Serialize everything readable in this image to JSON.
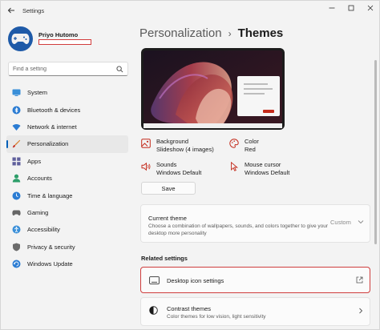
{
  "window": {
    "title": "Settings",
    "back_icon": "arrow-left-icon",
    "controls": [
      "minimize",
      "maximize",
      "close"
    ]
  },
  "user": {
    "name": "Priyo Hutomo",
    "email": ""
  },
  "search": {
    "placeholder": "Find a setting",
    "value": ""
  },
  "sidebar": {
    "items": [
      {
        "label": "System",
        "icon": "monitor-icon",
        "active": false
      },
      {
        "label": "Bluetooth & devices",
        "icon": "bluetooth-icon",
        "active": false
      },
      {
        "label": "Network & internet",
        "icon": "wifi-icon",
        "active": false
      },
      {
        "label": "Personalization",
        "icon": "brush-icon",
        "active": true
      },
      {
        "label": "Apps",
        "icon": "apps-icon",
        "active": false
      },
      {
        "label": "Accounts",
        "icon": "person-icon",
        "active": false
      },
      {
        "label": "Time & language",
        "icon": "globe-clock-icon",
        "active": false
      },
      {
        "label": "Gaming",
        "icon": "gamepad-icon",
        "active": false
      },
      {
        "label": "Accessibility",
        "icon": "accessibility-icon",
        "active": false
      },
      {
        "label": "Privacy & security",
        "icon": "shield-icon",
        "active": false
      },
      {
        "label": "Windows Update",
        "icon": "refresh-icon",
        "active": false
      }
    ]
  },
  "breadcrumb": {
    "parent": "Personalization",
    "separator": "›",
    "current": "Themes"
  },
  "theme_props": {
    "background": {
      "title": "Background",
      "value": "Slideshow (4 images)"
    },
    "color": {
      "title": "Color",
      "value": "Red"
    },
    "sounds": {
      "title": "Sounds",
      "value": "Windows Default"
    },
    "cursor": {
      "title": "Mouse cursor",
      "value": "Windows Default"
    }
  },
  "save_label": "Save",
  "current_theme": {
    "title": "Current theme",
    "description": "Choose a combination of wallpapers, sounds, and colors together to give your desktop more personality",
    "dropdown_label": "Custom"
  },
  "related_settings": {
    "title": "Related settings",
    "desktop_icon": {
      "label": "Desktop icon settings"
    },
    "contrast": {
      "title": "Contrast themes",
      "description": "Color themes for low vision, light sensitivity"
    }
  },
  "colors": {
    "accent": "#005fb8",
    "highlight_border": "#cf3d3d",
    "icon_red": "#c42b1c"
  }
}
